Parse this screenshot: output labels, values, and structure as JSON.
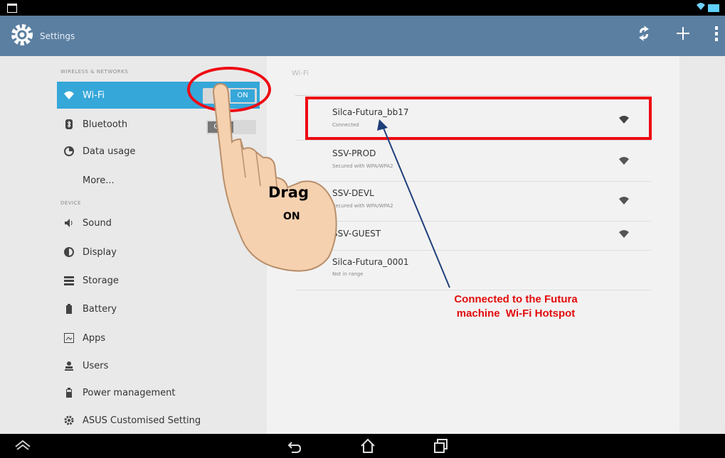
{
  "actionbar": {
    "title": "Settings"
  },
  "sidebar": {
    "sections": [
      "WIRELESS & NETWORKS",
      "DEVICE"
    ],
    "items": [
      {
        "label": "Wi-Fi",
        "icon": "wifi-icon",
        "selected": true
      },
      {
        "label": "Bluetooth",
        "icon": "bluetooth-icon"
      },
      {
        "label": "Data usage",
        "icon": "data-usage-icon"
      },
      {
        "label": "More..."
      },
      {
        "label": "Sound",
        "icon": "sound-icon"
      },
      {
        "label": "Display",
        "icon": "display-icon"
      },
      {
        "label": "Storage",
        "icon": "storage-icon"
      },
      {
        "label": "Battery",
        "icon": "battery-icon"
      },
      {
        "label": "Apps",
        "icon": "apps-icon"
      },
      {
        "label": "Users",
        "icon": "users-icon"
      },
      {
        "label": "Power management",
        "icon": "power-icon"
      },
      {
        "label": "ASUS Customised Setting",
        "icon": "gear-icon"
      }
    ],
    "wifi_toggle": "ON",
    "bluetooth_toggle": "OFF"
  },
  "wifi": {
    "header": "Wi-Fi",
    "networks": [
      {
        "name": "Silca-Futura_bb17",
        "status": "Connected"
      },
      {
        "name": "SSV-PROD",
        "status": "Secured with WPA/WPA2"
      },
      {
        "name": "SSV-DEVL",
        "status": "Secured with WPA/WPA2"
      },
      {
        "name": "SSV-GUEST",
        "status": ""
      },
      {
        "name": "Silca-Futura_0001",
        "status": "Not in range"
      }
    ]
  },
  "annotations": {
    "drag_word": "Drag",
    "drag_on": "ON",
    "callout_line1": "Connected to the Futura",
    "callout_line2": "machine  Wi-Fi Hotspot"
  },
  "colors": {
    "actionbar": "#5b7fa1",
    "selected": "#35a7d9",
    "highlight": "#ee0a12",
    "arrow": "#1f3f7a"
  }
}
